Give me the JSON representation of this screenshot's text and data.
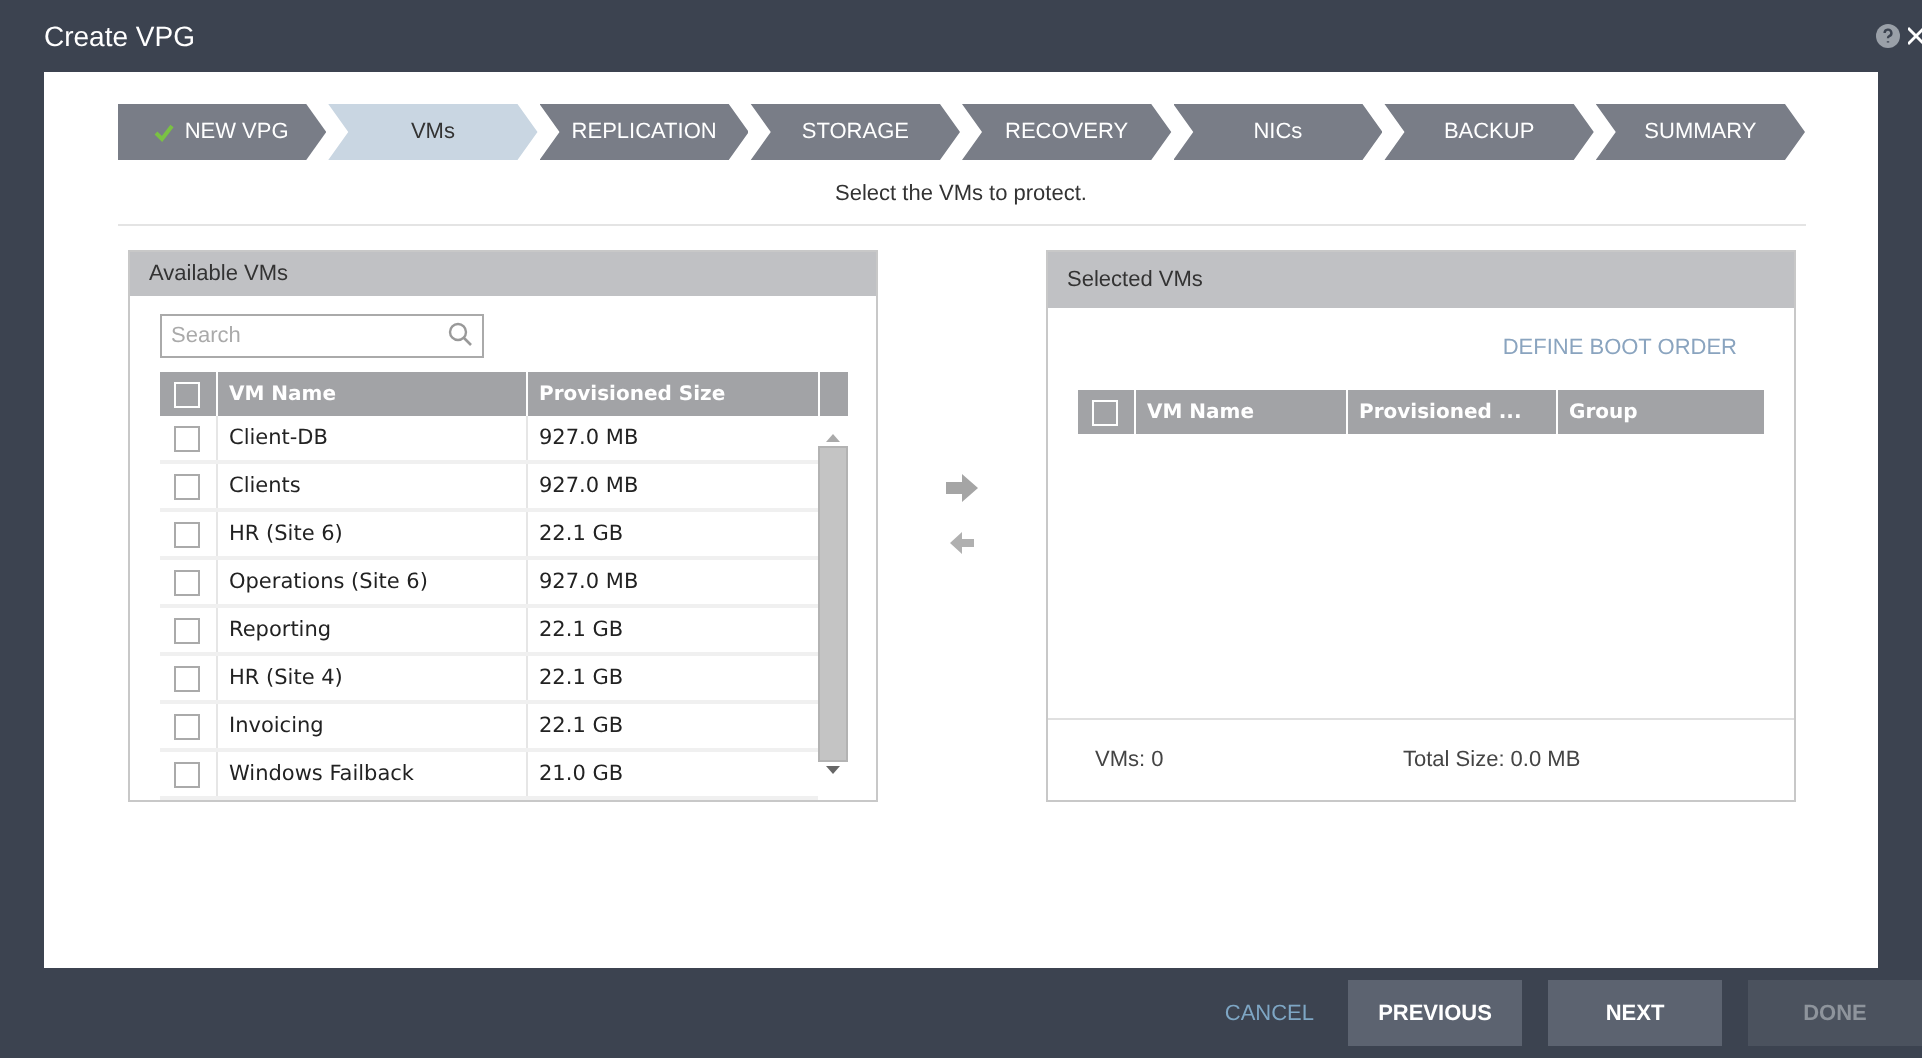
{
  "window": {
    "title": "Create VPG"
  },
  "steps": [
    {
      "label": "NEW VPG",
      "completed": true,
      "selected": false
    },
    {
      "label": "VMs",
      "completed": false,
      "selected": true
    },
    {
      "label": "REPLICATION",
      "completed": false,
      "selected": false
    },
    {
      "label": "STORAGE",
      "completed": false,
      "selected": false
    },
    {
      "label": "RECOVERY",
      "completed": false,
      "selected": false
    },
    {
      "label": "NICs",
      "completed": false,
      "selected": false
    },
    {
      "label": "BACKUP",
      "completed": false,
      "selected": false
    },
    {
      "label": "SUMMARY",
      "completed": false,
      "selected": false
    }
  ],
  "instruction": "Select the VMs to protect.",
  "available": {
    "title": "Available VMs",
    "search": {
      "placeholder": "Search"
    },
    "columns": [
      "VM Name",
      "Provisioned Size"
    ],
    "select_all_checked": false,
    "rows": [
      {
        "name": "Client-DB",
        "size": "927.0 MB",
        "checked": false
      },
      {
        "name": "Clients",
        "size": "927.0 MB",
        "checked": false
      },
      {
        "name": "HR (Site 6)",
        "size": "22.1 GB",
        "checked": false
      },
      {
        "name": "Operations (Site 6)",
        "size": "927.0 MB",
        "checked": false
      },
      {
        "name": "Reporting",
        "size": "22.1 GB",
        "checked": false
      },
      {
        "name": "HR (Site 4)",
        "size": "22.1 GB",
        "checked": false
      },
      {
        "name": "Invoicing",
        "size": "22.1 GB",
        "checked": false
      },
      {
        "name": "Windows Failback",
        "size": "21.0 GB",
        "checked": false
      }
    ]
  },
  "selected": {
    "title": "Selected VMs",
    "link": "DEFINE BOOT ORDER",
    "columns": [
      "VM Name",
      "Provisioned ...",
      "Group"
    ],
    "select_all_checked": false,
    "count": "VMs: 0",
    "total": "Total Size: 0.0 MB"
  },
  "buttons": [
    {
      "label": "CANCEL",
      "kind": "link",
      "disabled": false
    },
    {
      "label": "PREVIOUS",
      "kind": "button",
      "disabled": false
    },
    {
      "label": "NEXT",
      "kind": "button",
      "disabled": false
    },
    {
      "label": "DONE",
      "kind": "button",
      "disabled": true
    }
  ]
}
